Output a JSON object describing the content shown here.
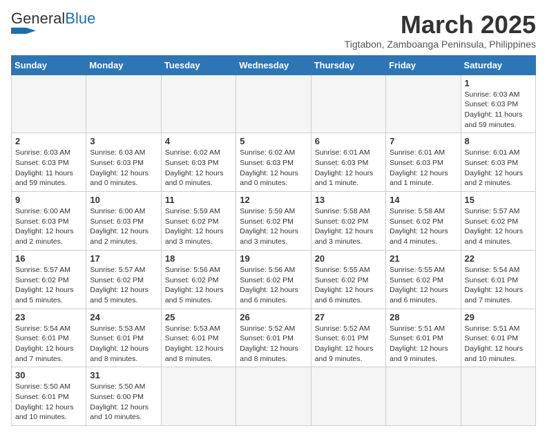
{
  "header": {
    "logo_general": "General",
    "logo_blue": "Blue",
    "month_title": "March 2025",
    "subtitle": "Tigtabon, Zamboanga Peninsula, Philippines"
  },
  "weekdays": [
    "Sunday",
    "Monday",
    "Tuesday",
    "Wednesday",
    "Thursday",
    "Friday",
    "Saturday"
  ],
  "weeks": [
    [
      {
        "day": "",
        "info": ""
      },
      {
        "day": "",
        "info": ""
      },
      {
        "day": "",
        "info": ""
      },
      {
        "day": "",
        "info": ""
      },
      {
        "day": "",
        "info": ""
      },
      {
        "day": "",
        "info": ""
      },
      {
        "day": "1",
        "info": "Sunrise: 6:03 AM\nSunset: 6:03 PM\nDaylight: 11 hours and 59 minutes."
      }
    ],
    [
      {
        "day": "2",
        "info": "Sunrise: 6:03 AM\nSunset: 6:03 PM\nDaylight: 11 hours and 59 minutes."
      },
      {
        "day": "3",
        "info": "Sunrise: 6:03 AM\nSunset: 6:03 PM\nDaylight: 12 hours and 0 minutes."
      },
      {
        "day": "4",
        "info": "Sunrise: 6:02 AM\nSunset: 6:03 PM\nDaylight: 12 hours and 0 minutes."
      },
      {
        "day": "5",
        "info": "Sunrise: 6:02 AM\nSunset: 6:03 PM\nDaylight: 12 hours and 0 minutes."
      },
      {
        "day": "6",
        "info": "Sunrise: 6:01 AM\nSunset: 6:03 PM\nDaylight: 12 hours and 1 minute."
      },
      {
        "day": "7",
        "info": "Sunrise: 6:01 AM\nSunset: 6:03 PM\nDaylight: 12 hours and 1 minute."
      },
      {
        "day": "8",
        "info": "Sunrise: 6:01 AM\nSunset: 6:03 PM\nDaylight: 12 hours and 2 minutes."
      }
    ],
    [
      {
        "day": "9",
        "info": "Sunrise: 6:00 AM\nSunset: 6:03 PM\nDaylight: 12 hours and 2 minutes."
      },
      {
        "day": "10",
        "info": "Sunrise: 6:00 AM\nSunset: 6:03 PM\nDaylight: 12 hours and 2 minutes."
      },
      {
        "day": "11",
        "info": "Sunrise: 5:59 AM\nSunset: 6:02 PM\nDaylight: 12 hours and 3 minutes."
      },
      {
        "day": "12",
        "info": "Sunrise: 5:59 AM\nSunset: 6:02 PM\nDaylight: 12 hours and 3 minutes."
      },
      {
        "day": "13",
        "info": "Sunrise: 5:58 AM\nSunset: 6:02 PM\nDaylight: 12 hours and 3 minutes."
      },
      {
        "day": "14",
        "info": "Sunrise: 5:58 AM\nSunset: 6:02 PM\nDaylight: 12 hours and 4 minutes."
      },
      {
        "day": "15",
        "info": "Sunrise: 5:57 AM\nSunset: 6:02 PM\nDaylight: 12 hours and 4 minutes."
      }
    ],
    [
      {
        "day": "16",
        "info": "Sunrise: 5:57 AM\nSunset: 6:02 PM\nDaylight: 12 hours and 5 minutes."
      },
      {
        "day": "17",
        "info": "Sunrise: 5:57 AM\nSunset: 6:02 PM\nDaylight: 12 hours and 5 minutes."
      },
      {
        "day": "18",
        "info": "Sunrise: 5:56 AM\nSunset: 6:02 PM\nDaylight: 12 hours and 5 minutes."
      },
      {
        "day": "19",
        "info": "Sunrise: 5:56 AM\nSunset: 6:02 PM\nDaylight: 12 hours and 6 minutes."
      },
      {
        "day": "20",
        "info": "Sunrise: 5:55 AM\nSunset: 6:02 PM\nDaylight: 12 hours and 6 minutes."
      },
      {
        "day": "21",
        "info": "Sunrise: 5:55 AM\nSunset: 6:02 PM\nDaylight: 12 hours and 6 minutes."
      },
      {
        "day": "22",
        "info": "Sunrise: 5:54 AM\nSunset: 6:01 PM\nDaylight: 12 hours and 7 minutes."
      }
    ],
    [
      {
        "day": "23",
        "info": "Sunrise: 5:54 AM\nSunset: 6:01 PM\nDaylight: 12 hours and 7 minutes."
      },
      {
        "day": "24",
        "info": "Sunrise: 5:53 AM\nSunset: 6:01 PM\nDaylight: 12 hours and 8 minutes."
      },
      {
        "day": "25",
        "info": "Sunrise: 5:53 AM\nSunset: 6:01 PM\nDaylight: 12 hours and 8 minutes."
      },
      {
        "day": "26",
        "info": "Sunrise: 5:52 AM\nSunset: 6:01 PM\nDaylight: 12 hours and 8 minutes."
      },
      {
        "day": "27",
        "info": "Sunrise: 5:52 AM\nSunset: 6:01 PM\nDaylight: 12 hours and 9 minutes."
      },
      {
        "day": "28",
        "info": "Sunrise: 5:51 AM\nSunset: 6:01 PM\nDaylight: 12 hours and 9 minutes."
      },
      {
        "day": "29",
        "info": "Sunrise: 5:51 AM\nSunset: 6:01 PM\nDaylight: 12 hours and 10 minutes."
      }
    ],
    [
      {
        "day": "30",
        "info": "Sunrise: 5:50 AM\nSunset: 6:01 PM\nDaylight: 12 hours and 10 minutes."
      },
      {
        "day": "31",
        "info": "Sunrise: 5:50 AM\nSunset: 6:00 PM\nDaylight: 12 hours and 10 minutes."
      },
      {
        "day": "",
        "info": ""
      },
      {
        "day": "",
        "info": ""
      },
      {
        "day": "",
        "info": ""
      },
      {
        "day": "",
        "info": ""
      },
      {
        "day": "",
        "info": ""
      }
    ]
  ]
}
